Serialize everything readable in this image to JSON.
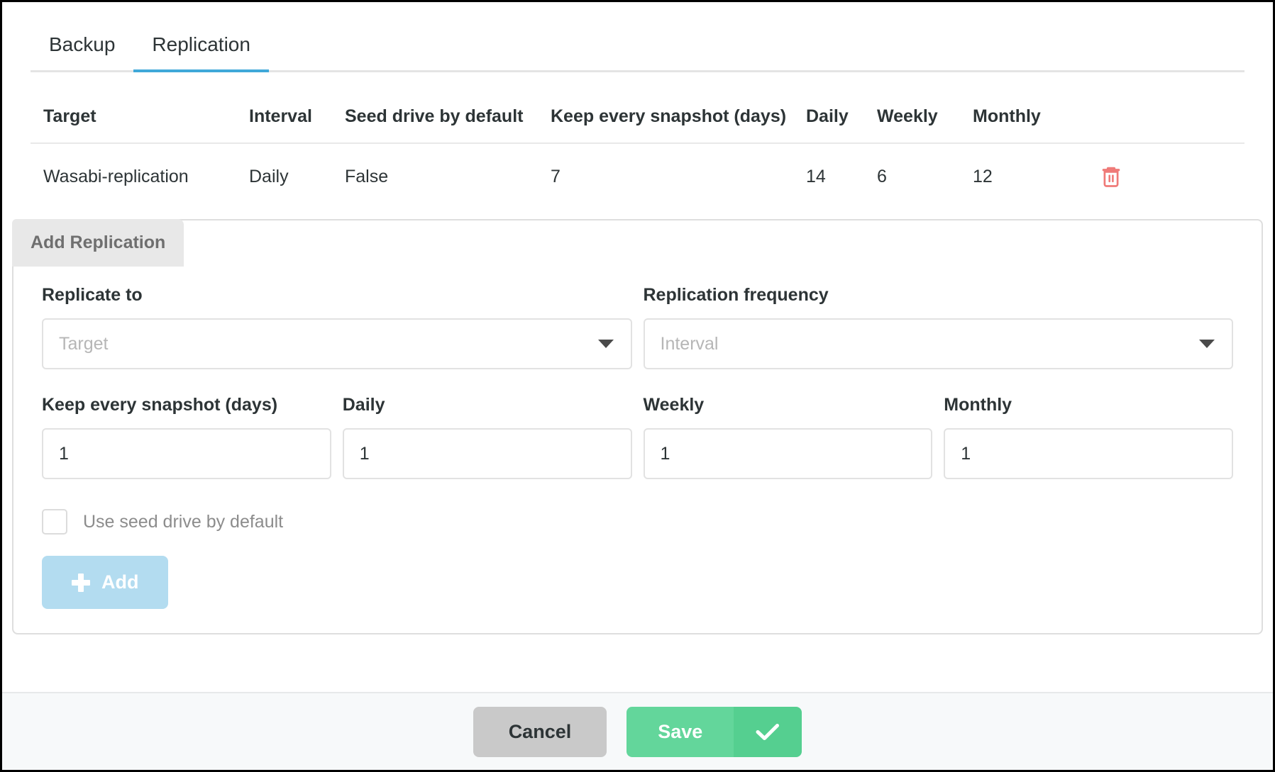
{
  "tabs": [
    {
      "label": "Backup",
      "active": false
    },
    {
      "label": "Replication",
      "active": true
    }
  ],
  "accent": {
    "tab_underline": "#40a8d9",
    "delete_icon": "#ef7a78",
    "add_button": "#b3dcf0",
    "save_button": "#63d69b",
    "cancel_button": "#c9c9c9",
    "panel_tab": "#e8e8e8"
  },
  "table": {
    "columns": [
      "Target",
      "Interval",
      "Seed drive by default",
      "Keep every snapshot (days)",
      "Daily",
      "Weekly",
      "Monthly"
    ],
    "rows": [
      {
        "target": "Wasabi-replication",
        "interval": "Daily",
        "seed_drive_by_default": "False",
        "keep_every_snapshot_days": "7",
        "daily": "14",
        "weekly": "6",
        "monthly": "12",
        "delete_icon": "trash-icon"
      }
    ]
  },
  "panel": {
    "tab_label": "Add Replication",
    "replicate_to": {
      "label": "Replicate to",
      "placeholder": "Target",
      "value": "",
      "caret_icon": "chevron-down-icon"
    },
    "replication_frequency": {
      "label": "Replication frequency",
      "placeholder": "Interval",
      "value": "",
      "caret_icon": "chevron-down-icon"
    },
    "numbers": [
      {
        "label": "Keep every snapshot (days)",
        "value": "1"
      },
      {
        "label": "Daily",
        "value": "1"
      },
      {
        "label": "Weekly",
        "value": "1"
      },
      {
        "label": "Monthly",
        "value": "1"
      }
    ],
    "checkbox": {
      "label": "Use seed drive by default",
      "checked": false
    },
    "add_button": {
      "label": "Add",
      "icon": "plus-icon"
    }
  },
  "footer": {
    "cancel_label": "Cancel",
    "save_label": "Save",
    "save_icon": "check-icon"
  }
}
